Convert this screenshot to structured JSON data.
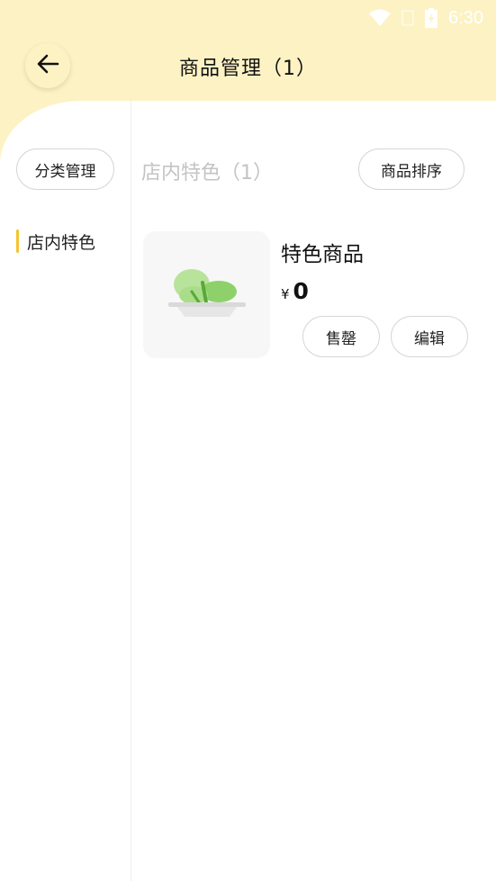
{
  "status_bar": {
    "time": "6:30",
    "icons": [
      "wifi-icon",
      "signal-icon",
      "battery-charging-icon"
    ]
  },
  "header": {
    "title": "商品管理（1）",
    "back_icon": "arrow-left-icon"
  },
  "sidebar": {
    "category_mgmt_label": "分类管理",
    "items": [
      {
        "label": "店内特色",
        "active": true
      }
    ]
  },
  "main": {
    "section_title": "店内特色（1）",
    "sort_label": "商品排序",
    "products": [
      {
        "name": "特色商品",
        "currency": "¥",
        "price": "0",
        "image_icon": "lettuce-dish-icon",
        "soldout_label": "售罄",
        "edit_label": "编辑"
      }
    ]
  },
  "colors": {
    "header_bg": "#fdf2c4",
    "accent": "#f4c430",
    "dish_green": "#8ed16a"
  }
}
